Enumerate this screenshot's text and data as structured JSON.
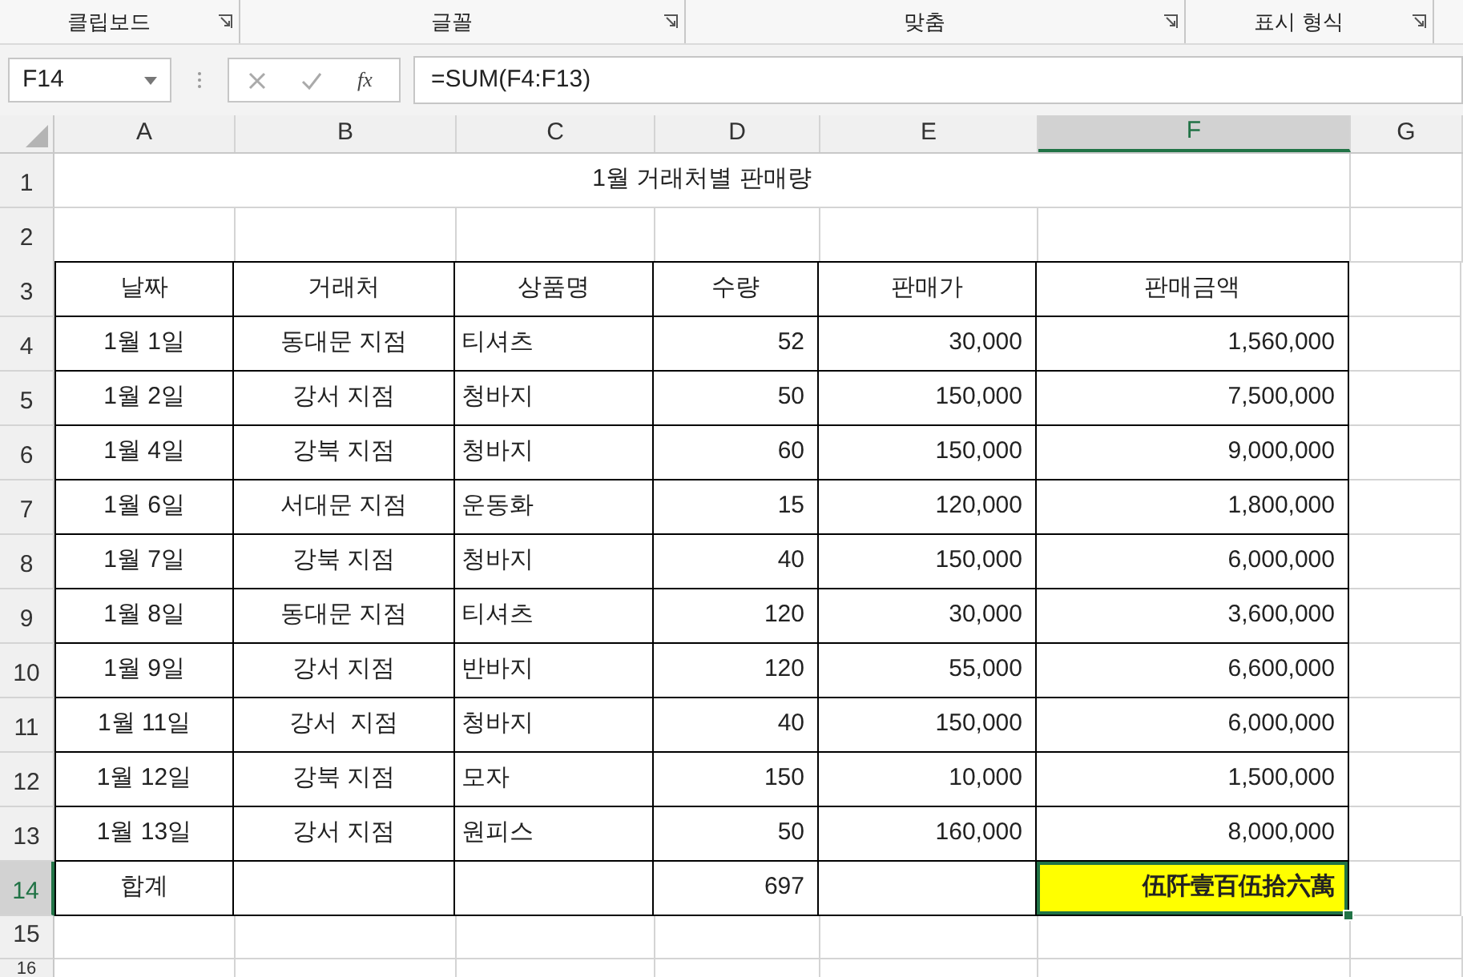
{
  "ribbon_groups": [
    {
      "label": "클립보드"
    },
    {
      "label": "글꼴"
    },
    {
      "label": "맞춤"
    },
    {
      "label": "표시 형식"
    }
  ],
  "name_box": {
    "value": "F14"
  },
  "formula_bar": {
    "function_label": "fx",
    "value": "=SUM(F4:F13)"
  },
  "columns": [
    {
      "label": "A",
      "selected": false
    },
    {
      "label": "B",
      "selected": false
    },
    {
      "label": "C",
      "selected": false
    },
    {
      "label": "D",
      "selected": false
    },
    {
      "label": "E",
      "selected": false
    },
    {
      "label": "F",
      "selected": true
    },
    {
      "label": "G",
      "selected": false
    }
  ],
  "rows": [
    {
      "number": "1",
      "selected": false,
      "kind": "title",
      "title": "1월 거래처별 판매량"
    },
    {
      "number": "2",
      "selected": false,
      "kind": "blank"
    },
    {
      "number": "3",
      "selected": false,
      "kind": "header",
      "cells": [
        "날짜",
        "거래처",
        "상품명",
        "수량",
        "판매가",
        "판매금액"
      ]
    },
    {
      "number": "4",
      "selected": false,
      "kind": "table",
      "cells": [
        "1월 1일",
        "동대문 지점",
        "티셔츠",
        "52",
        "30,000",
        "1,560,000"
      ]
    },
    {
      "number": "5",
      "selected": false,
      "kind": "table",
      "cells": [
        "1월 2일",
        "강서 지점",
        "청바지",
        "50",
        "150,000",
        "7,500,000"
      ]
    },
    {
      "number": "6",
      "selected": false,
      "kind": "table",
      "cells": [
        "1월 4일",
        "강북 지점",
        "청바지",
        "60",
        "150,000",
        "9,000,000"
      ]
    },
    {
      "number": "7",
      "selected": false,
      "kind": "table",
      "cells": [
        "1월 6일",
        "서대문 지점",
        "운동화",
        "15",
        "120,000",
        "1,800,000"
      ]
    },
    {
      "number": "8",
      "selected": false,
      "kind": "table",
      "cells": [
        "1월 7일",
        "강북 지점",
        "청바지",
        "40",
        "150,000",
        "6,000,000"
      ]
    },
    {
      "number": "9",
      "selected": false,
      "kind": "table",
      "cells": [
        "1월 8일",
        "동대문 지점",
        "티셔츠",
        "120",
        "30,000",
        "3,600,000"
      ]
    },
    {
      "number": "10",
      "selected": false,
      "kind": "table",
      "cells": [
        "1월 9일",
        "강서 지점",
        "반바지",
        "120",
        "55,000",
        "6,600,000"
      ]
    },
    {
      "number": "11",
      "selected": false,
      "kind": "table",
      "cells": [
        "1월 11일",
        "강서  지점",
        "청바지",
        "40",
        "150,000",
        "6,000,000"
      ]
    },
    {
      "number": "12",
      "selected": false,
      "kind": "table",
      "cells": [
        "1월 12일",
        "강북 지점",
        "모자",
        "150",
        "10,000",
        "1,500,000"
      ]
    },
    {
      "number": "13",
      "selected": false,
      "kind": "table",
      "cells": [
        "1월 13일",
        "강서 지점",
        "원피스",
        "50",
        "160,000",
        "8,000,000"
      ]
    },
    {
      "number": "14",
      "selected": true,
      "kind": "total",
      "cells": [
        "합계",
        null,
        null,
        "697",
        null,
        {
          "text": "伍阡壹百伍拾六萬",
          "bold": true,
          "color": "#ffff00"
        }
      ]
    },
    {
      "number": "15",
      "selected": false,
      "kind": "blank"
    },
    {
      "number": "16",
      "selected": false,
      "kind": "blank"
    }
  ]
}
